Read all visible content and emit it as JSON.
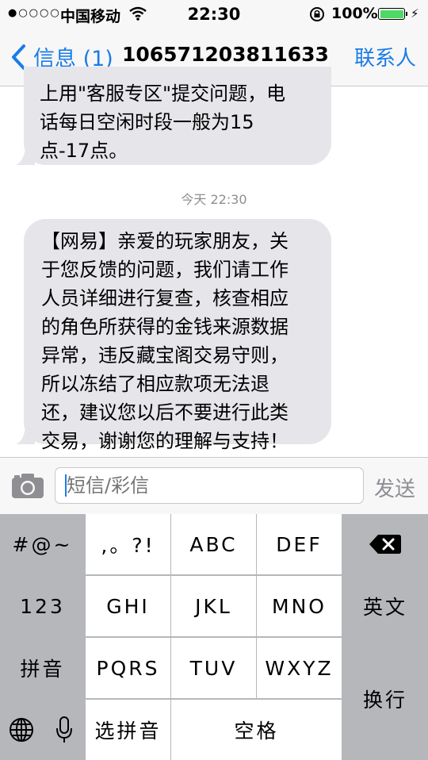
{
  "status_bar": {
    "signal": "●○○○○",
    "carrier": "中国移动",
    "time": "22:30",
    "battery_percent": "100%"
  },
  "nav": {
    "back_label": "信息 (1)",
    "title": "106571203811633",
    "contact_label": "联系人"
  },
  "messages": [
    {
      "lines": [
        "上用\"客服专区\"提交问题，电",
        "话每日空闲时段一般为15",
        "点-17点。"
      ]
    },
    {
      "lines": [
        "【网易】亲爱的玩家朋友，关",
        "于您反馈的问题，我们请工作",
        "人员详细进行复查，核查相应",
        "的角色所获得的金钱来源数据",
        "异常，违反藏宝阁交易守则，",
        "所以冻结了相应款项无法退",
        "还，建议您以后不要进行此类",
        "交易，谢谢您的理解与支持！"
      ]
    }
  ],
  "timestamp": "今天 22:30",
  "input": {
    "placeholder": "短信/彩信",
    "send_label": "发送"
  },
  "keyboard": {
    "symbols": "#@~",
    "punct": ",。?!",
    "abc": "ABC",
    "def": "DEF",
    "num": "123",
    "ghi": "GHI",
    "jkl": "JKL",
    "mno": "MNO",
    "english": "英文",
    "pinyin": "拼音",
    "pqrs": "PQRS",
    "tuv": "TUV",
    "wxyz": "WXYZ",
    "return": "换行",
    "select_pinyin": "选拼音",
    "space": "空格"
  },
  "colors": {
    "accent": "#1a7ce8",
    "bubble": "#e5e5ea",
    "battery": "#4cd964",
    "keyboard_dark": "#b6b7bb"
  }
}
